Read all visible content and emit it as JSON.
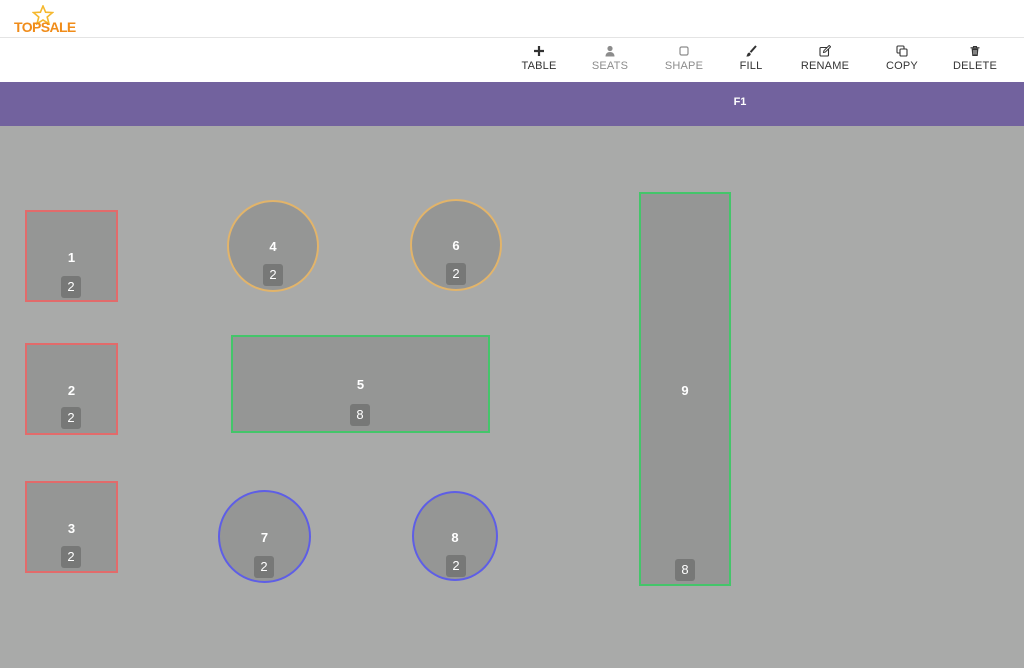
{
  "app": {
    "logo_text": "TOPSALE"
  },
  "toolbar": {
    "table": "TABLE",
    "seats": "SEATS",
    "shape": "SHAPE",
    "fill": "FILL",
    "rename": "RENAME",
    "copy": "COPY",
    "delete": "DELETE"
  },
  "floor": {
    "tab": "F1"
  },
  "tables": [
    {
      "name": "1",
      "seats": "2"
    },
    {
      "name": "2",
      "seats": "2"
    },
    {
      "name": "3",
      "seats": "2"
    },
    {
      "name": "4",
      "seats": "2"
    },
    {
      "name": "5",
      "seats": "8"
    },
    {
      "name": "6",
      "seats": "2"
    },
    {
      "name": "7",
      "seats": "2"
    },
    {
      "name": "8",
      "seats": "2"
    },
    {
      "name": "9",
      "seats": "8"
    }
  ],
  "colors": {
    "floor_bar": "#72629e",
    "canvas": "#a9aaa9",
    "table_fill": "#959695",
    "square_border": "#e26b6b",
    "round_orange_border": "#e2b46a",
    "round_blue_border": "#5e5ee6",
    "rect_green_border": "#44c56a",
    "logo": "#f08c1a"
  }
}
